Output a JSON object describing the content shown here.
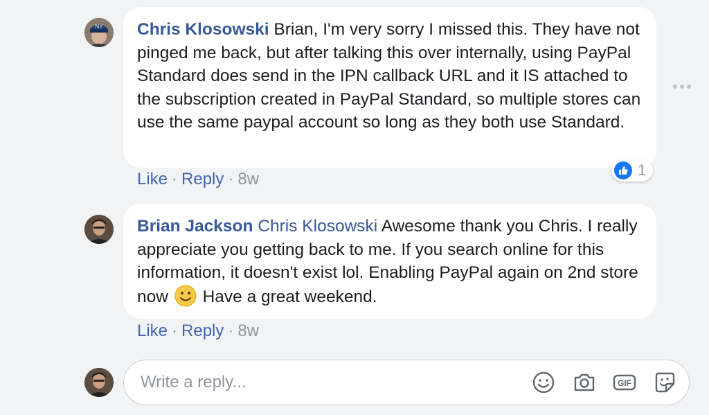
{
  "comments": [
    {
      "author": "Chris Klosowski",
      "text": "Brian, I'm very sorry I missed this. They have not pinged me back, but after talking this over internally, using PayPal Standard does send in the IPN callback URL and it IS attached to the subscription created in PayPal Standard, so multiple stores can use the same paypal account so long as they both use Standard.",
      "like_label": "Like",
      "reply_label": "Reply",
      "time": "8w",
      "reaction_count": "1"
    },
    {
      "author": "Brian Jackson",
      "mention": "Chris Klosowski",
      "text_before": "Awesome thank you Chris. I really appreciate you getting back to me. If you search online for this information, it doesn't exist lol. Enabling PayPal again on 2nd store now",
      "emoji": "smiley-emoji",
      "text_after": "Have a great weekend.",
      "like_label": "Like",
      "reply_label": "Reply",
      "time": "8w"
    }
  ],
  "reply_box": {
    "placeholder": "Write a reply...",
    "icons": [
      "emoji-icon",
      "camera-icon",
      "gif-icon",
      "sticker-icon"
    ]
  },
  "colors": {
    "link": "#385898",
    "action_link": "#4267b2",
    "meta": "#90949c",
    "like_blue": "#1877f2",
    "background": "#f2f3f5"
  }
}
